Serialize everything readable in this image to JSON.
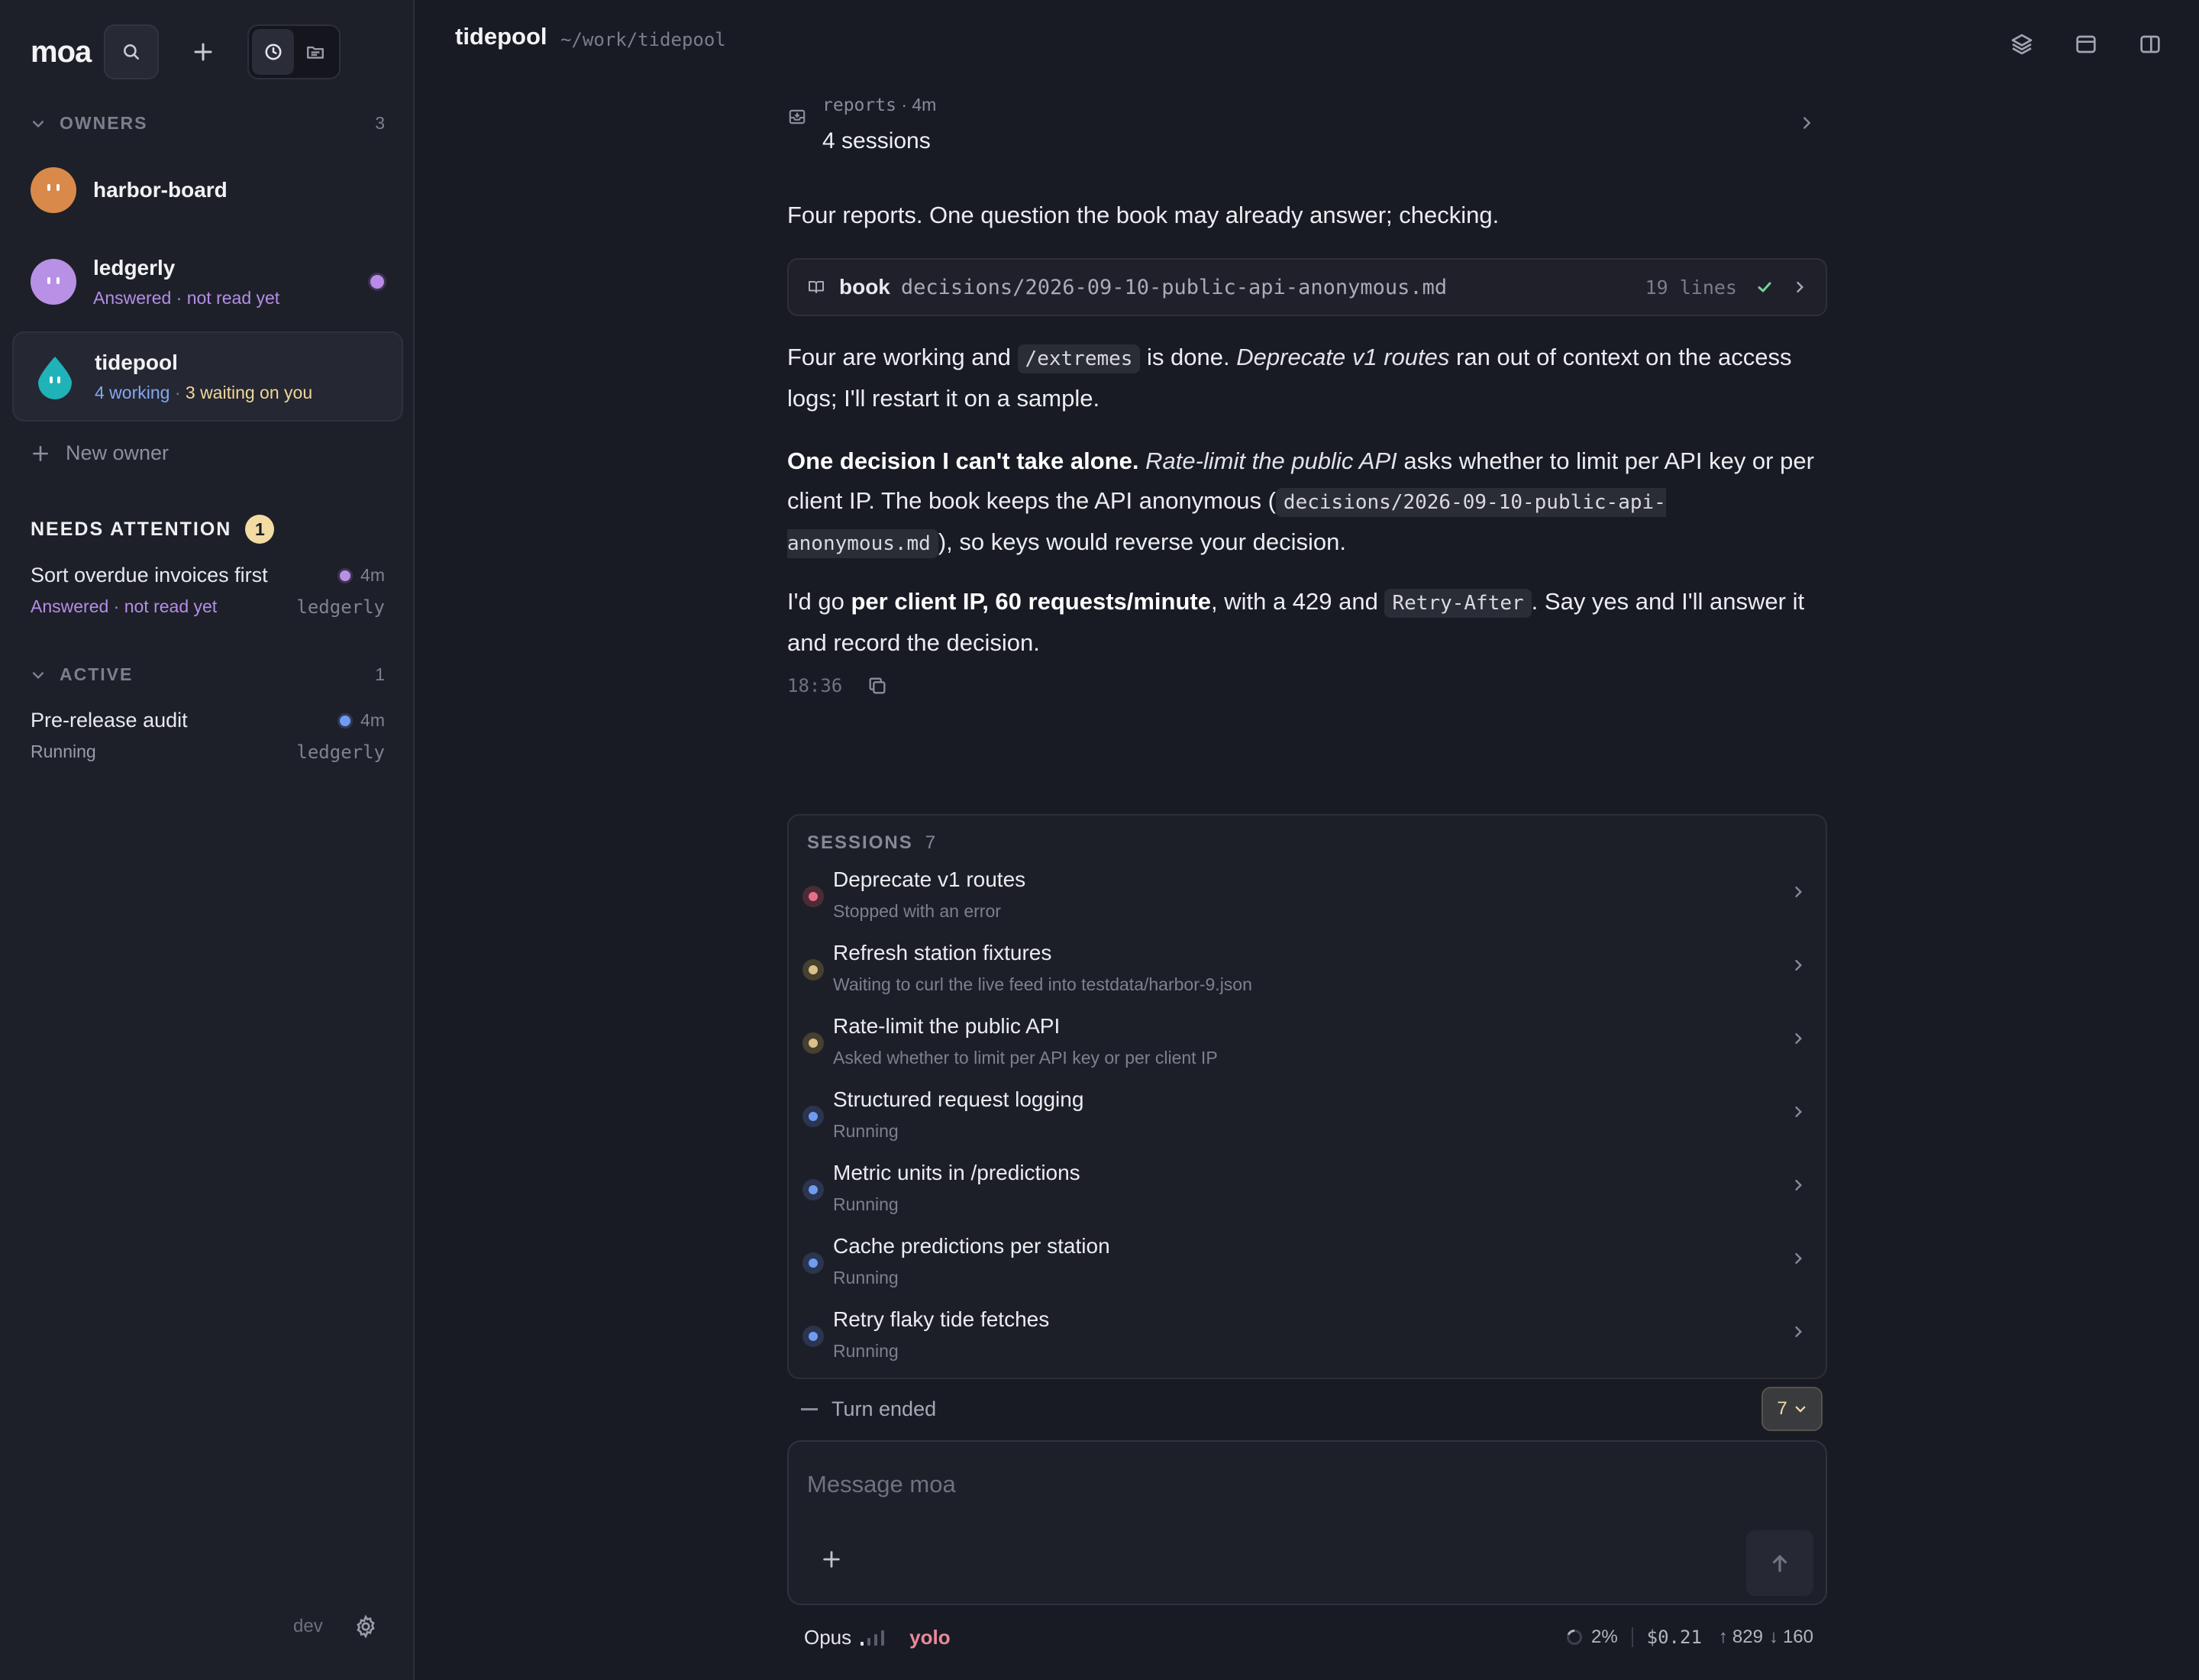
{
  "app": {
    "name": "moa"
  },
  "sidebar": {
    "owners_header": "OWNERS",
    "owners_count": "3",
    "owners": [
      {
        "name": "harbor-board",
        "sub": [],
        "avatar_color": "#d98a4a"
      },
      {
        "name": "ledgerly",
        "sub": [
          {
            "text": "Answered",
            "color": "#b48ee6"
          },
          {
            "text": " · not read yet",
            "color": "#b48ee6"
          }
        ],
        "avatar_color": "#b891e6",
        "unread_dot": true
      },
      {
        "name": "tidepool",
        "sub": [
          {
            "text": "4 working",
            "color": "#82a8f0"
          },
          {
            "text": " · ",
            "color": "#7c7f8e"
          },
          {
            "text": "3 waiting on you",
            "color": "#f0d79a"
          }
        ],
        "avatar_color": "#1fb3b8",
        "selected": true
      }
    ],
    "new_owner_label": "New owner",
    "needs_attention": {
      "header": "NEEDS ATTENTION",
      "count": "1",
      "items": [
        {
          "title": "Sort overdue invoices first",
          "time": "4m",
          "status": "Answered · not read yet",
          "owner": "ledgerly",
          "dot_color": "#b891e6"
        }
      ]
    },
    "active": {
      "header": "ACTIVE",
      "count": "1",
      "items": [
        {
          "title": "Pre-release audit",
          "time": "4m",
          "status": "Running",
          "owner": "ledgerly",
          "dot_color": "#6f9bf2"
        }
      ]
    },
    "footer_label": "dev"
  },
  "header": {
    "title": "tidepool",
    "path": "~/work/tidepool"
  },
  "conversation": {
    "reports_label": "reports",
    "reports_time": "· 4m",
    "reports_count": "4 sessions",
    "p1": "Four reports. One question the book may already answer; checking.",
    "book": {
      "word": "book",
      "path": "decisions/2026-09-10-public-api-anonymous.md",
      "lines": "19 lines"
    },
    "p2": {
      "a": "Four are working and ",
      "code": "/extremes",
      "b": " is done. ",
      "em": "Deprecate v1 routes",
      "c": " ran out of context on the access logs; I'll restart it on a sample."
    },
    "p3": {
      "strong": "One decision I can't take alone.",
      "a": " ",
      "em": "Rate-limit the public API",
      "b": " asks whether to limit per API key or per client IP. The book keeps the API anonymous (",
      "code": "decisions/2026-09-10-public-api-anonymous.md",
      "c": "), so keys would reverse your decision."
    },
    "p4": {
      "a": "I'd go ",
      "strong": "per client IP, 60 requests/minute",
      "b": ", with a 429 and ",
      "code": "Retry-After",
      "c": ". Say yes and I'll answer it and record the decision."
    },
    "timestamp": "18:36"
  },
  "sessions": {
    "header": "SESSIONS",
    "count": "7",
    "items": [
      {
        "title": "Deprecate v1 routes",
        "sub": "Stopped with an error",
        "color": "#e86d86"
      },
      {
        "title": "Refresh station fixtures",
        "sub": "Waiting to curl the live feed into testdata/harbor-9.json",
        "color": "#d9c18a"
      },
      {
        "title": "Rate-limit the public API",
        "sub": "Asked whether to limit per API key or per client IP",
        "color": "#d9c18a"
      },
      {
        "title": "Structured request logging",
        "sub": "Running",
        "color": "#6f9bf2"
      },
      {
        "title": "Metric units in /predictions",
        "sub": "Running",
        "color": "#6f9bf2"
      },
      {
        "title": "Cache predictions per station",
        "sub": "Running",
        "color": "#6f9bf2"
      },
      {
        "title": "Retry flaky tide fetches",
        "sub": "Running",
        "color": "#6f9bf2"
      }
    ]
  },
  "turn": {
    "label": "Turn ended",
    "badge": "7"
  },
  "composer": {
    "placeholder": "Message moa"
  },
  "status_bar": {
    "model": "Opus",
    "mode": "yolo",
    "context": "2%",
    "cost": "$0.21",
    "tokens_up": "829",
    "tokens_down": "160"
  }
}
